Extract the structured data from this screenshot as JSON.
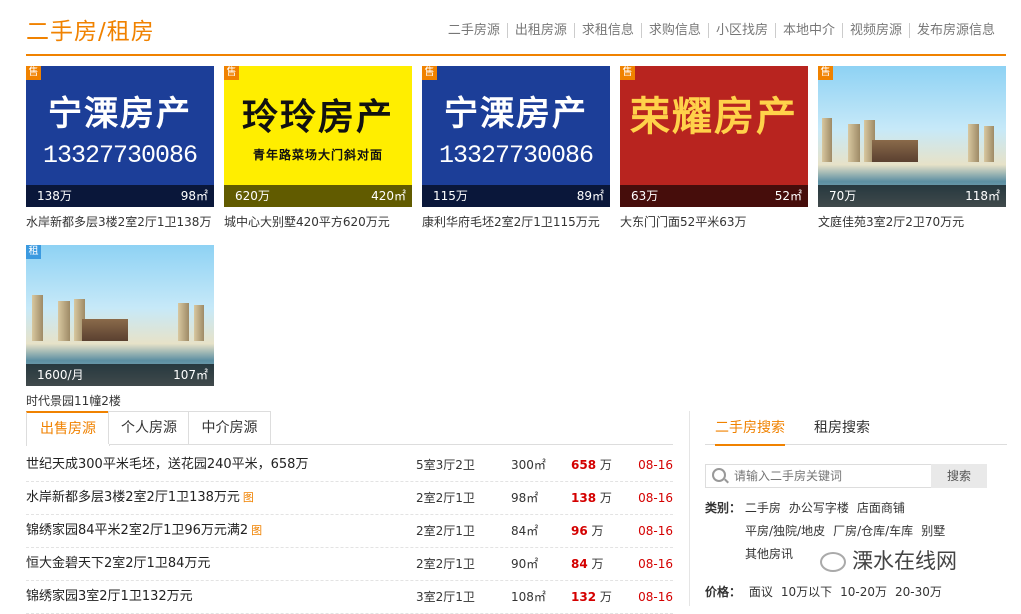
{
  "header": {
    "title": "二手房/租房",
    "nav": [
      "二手房源",
      "出租房源",
      "求租信息",
      "求购信息",
      "小区找房",
      "本地中介",
      "视频房源",
      "发布房源信息"
    ]
  },
  "cards": [
    {
      "tag": "售",
      "price": "138万",
      "area": "98㎡",
      "caption": "水岸新都多层3楼2室2厅1卫138万",
      "poster": {
        "name": "宁溧房产",
        "phone": "13327730086"
      }
    },
    {
      "tag": "售",
      "price": "620万",
      "area": "420㎡",
      "caption": "城中心大别墅420平方620万元",
      "poster": {
        "name": "玲玲房产",
        "sub": "青年路菜场大门斜对面"
      }
    },
    {
      "tag": "售",
      "price": "115万",
      "area": "89㎡",
      "caption": "康利华府毛坯2室2厅1卫115万元",
      "poster": {
        "name": "宁溧房产",
        "phone": "13327730086"
      }
    },
    {
      "tag": "售",
      "price": "63万",
      "area": "52㎡",
      "caption": "大东门门面52平米63万",
      "poster": {
        "name": "荣耀房产"
      }
    },
    {
      "tag": "售",
      "price": "70万",
      "area": "118㎡",
      "caption": "文庭佳苑3室2厅2卫70万元"
    },
    {
      "tag": "租",
      "price": "1600/月",
      "area": "107㎡",
      "caption": "时代景园11幢2楼"
    }
  ],
  "tabs": [
    "出售房源",
    "个人房源",
    "中介房源"
  ],
  "listings": [
    {
      "title": "世纪天成300平米毛坯，送花园240平米，658万",
      "img": "",
      "layout": "5室3厅2卫",
      "area": "300㎡",
      "price": "658",
      "unit": "万",
      "date": "08-16"
    },
    {
      "title": "水岸新都多层3楼2室2厅1卫138万元",
      "img": "图",
      "layout": "2室2厅1卫",
      "area": "98㎡",
      "price": "138",
      "unit": "万",
      "date": "08-16"
    },
    {
      "title": "锦绣家园84平米2室2厅1卫96万元满2",
      "img": "图",
      "layout": "2室2厅1卫",
      "area": "84㎡",
      "price": "96",
      "unit": "万",
      "date": "08-16"
    },
    {
      "title": "恒大金碧天下2室2厅1卫84万元",
      "img": "",
      "layout": "2室2厅1卫",
      "area": "90㎡",
      "price": "84",
      "unit": "万",
      "date": "08-16"
    },
    {
      "title": "锦绣家园3室2厅1卫132万元",
      "img": "",
      "layout": "3室2厅1卫",
      "area": "108㎡",
      "price": "132",
      "unit": "万",
      "date": "08-16"
    }
  ],
  "side": {
    "tabs": [
      "二手房搜索",
      "租房搜索"
    ],
    "search_placeholder": "请输入二手房关键词",
    "search_button": "搜索",
    "cat_label": "类别：",
    "cats": [
      "二手房",
      "办公写字楼",
      "店面商铺",
      "平房/独院/地皮",
      "厂房/仓库/车库",
      "别墅",
      "其他房讯"
    ],
    "price_label": "价格：",
    "prices": [
      "面议",
      "10万以下",
      "10-20万",
      "20-30万"
    ]
  },
  "watermark": "溧水在线网"
}
